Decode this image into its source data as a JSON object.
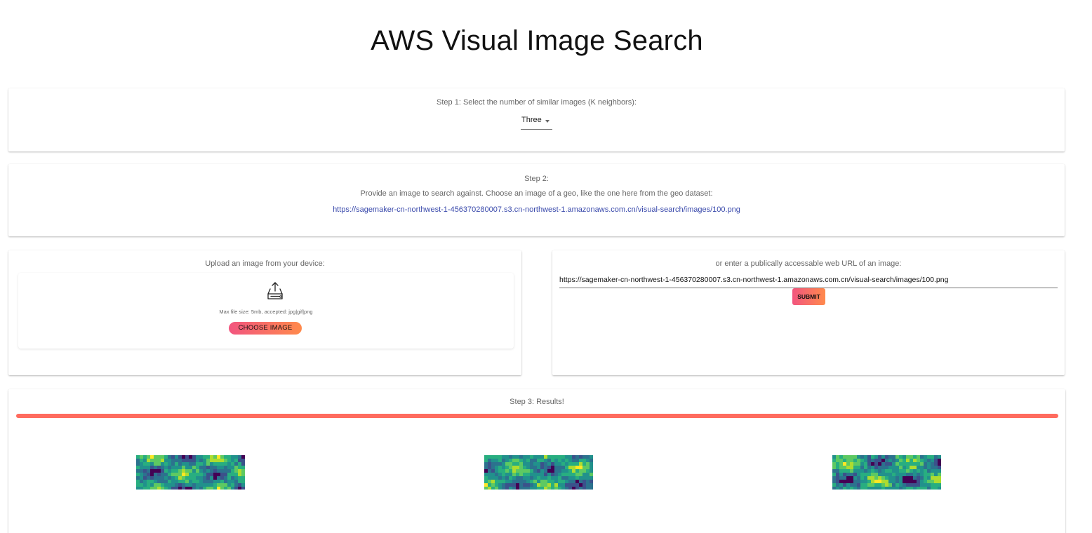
{
  "app": {
    "title": "AWS Visual Image Search"
  },
  "step1": {
    "label": "Step 1: Select the number of similar images (K neighbors):",
    "select": {
      "value": "Three"
    }
  },
  "step2": {
    "heading": "Step 2:",
    "description": "Provide an image to search against. Choose an image of a geo, like the one here from the geo dataset:",
    "sample_url": "https://sagemaker-cn-northwest-1-456370280007.s3.cn-northwest-1.amazonaws.com.cn/visual-search/images/100.png"
  },
  "upload": {
    "label": "Upload an image from your device:",
    "hint": "Max file size: 5mb, accepted: jpg|gif|png",
    "button_label": "CHOOSE IMAGE",
    "icon": "upload-tray-icon"
  },
  "url_input": {
    "label": "or enter a publically accessable web URL of an image:",
    "value": "https://sagemaker-cn-northwest-1-456370280007.s3.cn-northwest-1.amazonaws.com.cn/visual-search/images/100.png",
    "submit_label": "SUBMIT"
  },
  "results": {
    "heading": "Step 3: Results!",
    "progress": 1.0,
    "progress_color": "#ff6b5e",
    "images": [
      {
        "name": "result-image-1"
      },
      {
        "name": "result-image-2"
      },
      {
        "name": "result-image-3"
      }
    ]
  },
  "colors": {
    "button_gradient_start": "#f2557f",
    "button_gradient_end": "#ff8a4c",
    "link": "#3949ab"
  }
}
